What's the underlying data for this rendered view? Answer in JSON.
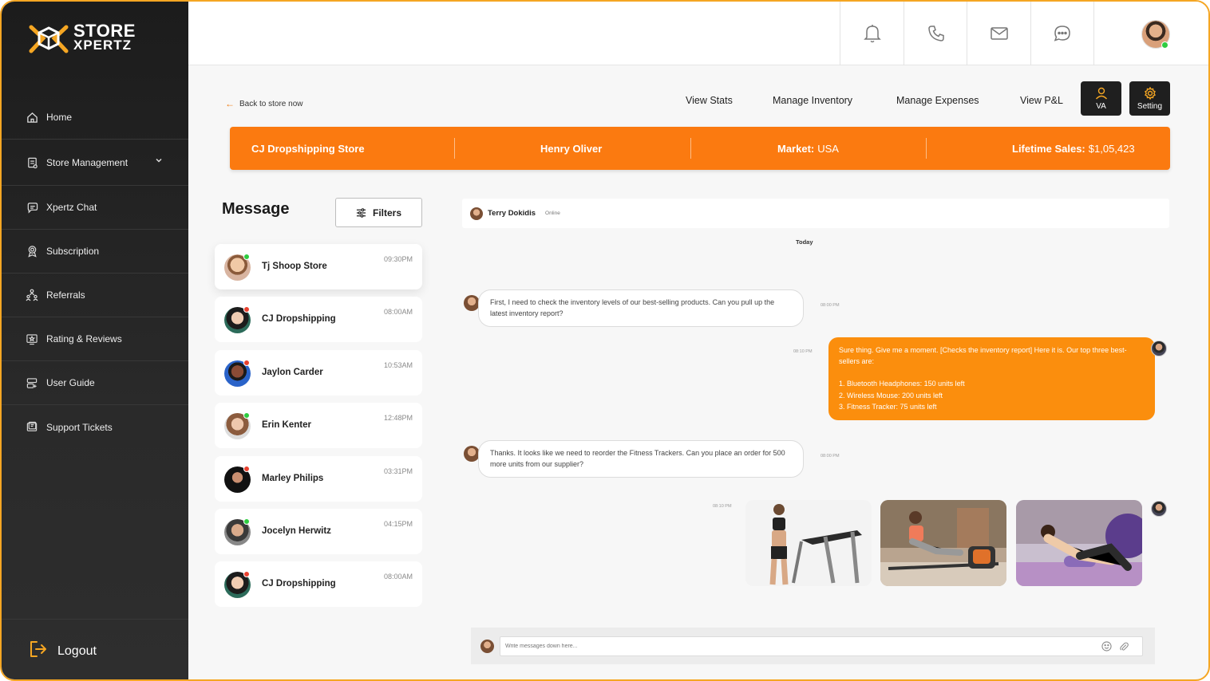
{
  "brand": {
    "line1": "STORE",
    "line2": "XPERTZ",
    "accent": "#f5a623"
  },
  "sidebar": {
    "items": [
      {
        "label": "Home",
        "icon": "home-icon"
      },
      {
        "label": "Store Management",
        "icon": "store-icon"
      },
      {
        "label": "Xpertz Chat",
        "icon": "chat-icon"
      },
      {
        "label": "Subscription",
        "icon": "award-icon"
      },
      {
        "label": "Referrals",
        "icon": "referrals-icon"
      },
      {
        "label": "Rating & Reviews",
        "icon": "star-icon"
      },
      {
        "label": "User Guide",
        "icon": "guide-icon"
      },
      {
        "label": "Support Tickets",
        "icon": "ticket-icon"
      }
    ],
    "logout": "Logout"
  },
  "topbar": {
    "icons": [
      "bell-icon",
      "phone-icon",
      "mail-icon",
      "chat-bubble-icon"
    ]
  },
  "header": {
    "back": "Back to store now",
    "links": [
      "View Stats",
      "Manage Inventory",
      "Manage Expenses",
      "View P&L"
    ],
    "va_label": "VA",
    "setting_label": "Setting"
  },
  "banner": {
    "store": "CJ Dropshipping Store",
    "owner": "Henry Oliver",
    "market_label": "Market:",
    "market_value": "USA",
    "sales_label": "Lifetime Sales:",
    "sales_value": "$1,05,423",
    "color": "#fb7a10"
  },
  "messages_panel": {
    "title": "Message",
    "filters": "Filters",
    "conversations": [
      {
        "name": "Tj Shoop Store",
        "time": "09:30PM",
        "status": "online"
      },
      {
        "name": "CJ Dropshipping",
        "time": "08:00AM",
        "status": "offline"
      },
      {
        "name": "Jaylon Carder",
        "time": "10:53AM",
        "status": "offline"
      },
      {
        "name": "Erin Kenter",
        "time": "12:48PM",
        "status": "online"
      },
      {
        "name": "Marley Philips",
        "time": "03:31PM",
        "status": "offline"
      },
      {
        "name": "Jocelyn Herwitz",
        "time": "04:15PM",
        "status": "online"
      },
      {
        "name": "CJ Dropshipping",
        "time": "08:00AM",
        "status": "online"
      }
    ]
  },
  "chat": {
    "contact": "Terry Dokidis",
    "status": "Online",
    "day": "Today",
    "messages": [
      {
        "from": "them",
        "time": "08:00 PM",
        "text": "First, I need to check the inventory levels of our best-selling products. Can you pull up the latest inventory report?"
      },
      {
        "from": "me",
        "time": "08:10 PM",
        "lines": [
          "Sure thing. Give me a moment. [Checks the inventory report] Here it is. Our top three best-sellers are:",
          "",
          "1. Bluetooth Headphones: 150 units left",
          "2. Wireless Mouse: 200 units left",
          "3. Fitness Tracker: 75 units left"
        ]
      },
      {
        "from": "them",
        "time": "08:00 PM",
        "text": "Thanks. It looks like we need to reorder the Fitness Trackers. Can you place an order for 500 more units from our supplier?"
      },
      {
        "from": "me",
        "time": "08:10 PM",
        "images": [
          "treadmill-photo",
          "rowing-machine-photo",
          "foam-roller-photo"
        ]
      }
    ],
    "input_placeholder": "Write messages down here..."
  }
}
